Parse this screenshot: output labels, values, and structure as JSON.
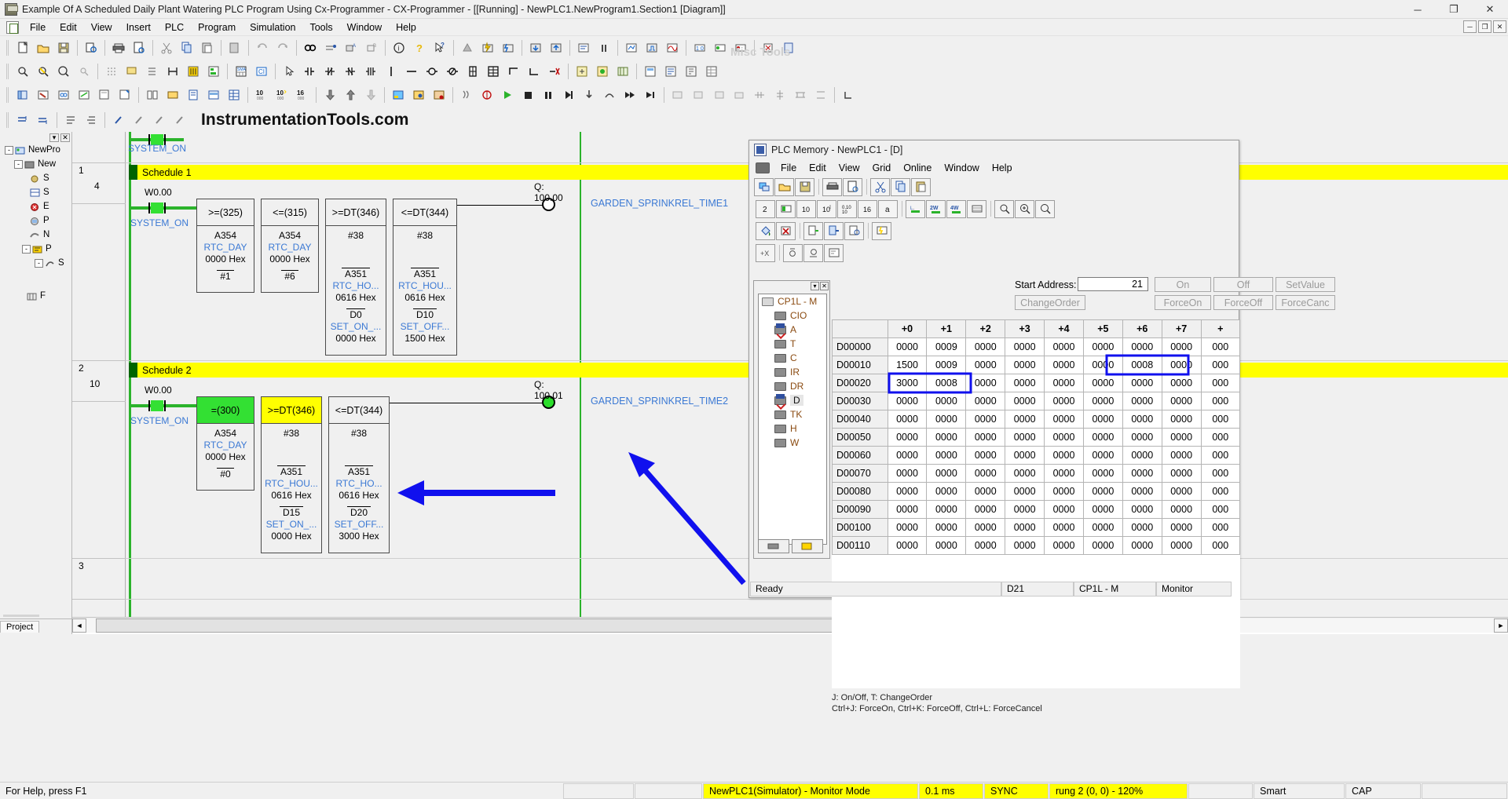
{
  "window": {
    "title": "Example Of A Scheduled Daily Plant Watering PLC Program Using Cx-Programmer - CX-Programmer - [[Running] - NewPLC1.NewProgram1.Section1 [Diagram]]",
    "minimize": "─",
    "maximize": "❐",
    "close": "✕",
    "mdi": [
      "─",
      "❐",
      "✕"
    ]
  },
  "menu": [
    "File",
    "Edit",
    "View",
    "Insert",
    "PLC",
    "Program",
    "Simulation",
    "Tools",
    "Window",
    "Help"
  ],
  "watermark": "InstrumentationTools.com",
  "ghost_label": "Misc Tools",
  "tree": {
    "close_btns": [
      "▾",
      "✕"
    ],
    "items": [
      {
        "label": "NewPro",
        "toggle": "-",
        "depth": 0,
        "icon": "project-icon"
      },
      {
        "label": "New",
        "toggle": "-",
        "depth": 1,
        "icon": "plc-icon"
      },
      {
        "label": "S",
        "toggle": "",
        "depth": 2,
        "icon": "symbol-icon"
      },
      {
        "label": "S",
        "toggle": "",
        "depth": 2,
        "icon": "iotable-icon"
      },
      {
        "label": "E",
        "toggle": "",
        "depth": 2,
        "icon": "error-icon"
      },
      {
        "label": "P",
        "toggle": "",
        "depth": 2,
        "icon": "memory-icon"
      },
      {
        "label": "N",
        "toggle": "",
        "depth": 2,
        "icon": "program-icon"
      },
      {
        "label": "P",
        "toggle": "-",
        "depth": 2,
        "icon": "section-icon"
      },
      {
        "label": "S",
        "toggle": "-",
        "depth": 3,
        "icon": "function-icon"
      },
      {
        "label": "F",
        "toggle": "",
        "depth": 2,
        "icon": "rack-icon"
      }
    ],
    "tab": "Project"
  },
  "ladder": {
    "rungs": [
      {
        "number": "",
        "step": "",
        "comment": ""
      },
      {
        "number": "1",
        "step": "4",
        "comment": "Schedule 1"
      },
      {
        "number": "2",
        "step": "10",
        "comment": "Schedule 2"
      },
      {
        "number": "3",
        "step": "",
        "comment": ""
      }
    ],
    "rung0": {
      "contact_label_bottom": "SYSTEM_ON"
    },
    "rung1": {
      "contact_top": "W0.00",
      "contact_bottom": "SYSTEM_ON",
      "coil_label": "Q: 100.00",
      "output_symbol": "GARDEN_SPRINKREL_TIME1",
      "blocks": [
        {
          "header": ">=(325)",
          "op1": "A354",
          "sym1": "RTC_DAY",
          "hex1": "0000 Hex",
          "op2": "#1",
          "sym2": "",
          "hex2": "",
          "op3": "",
          "sym3": "",
          "hex3": "",
          "fill": "plain"
        },
        {
          "header": "<=(315)",
          "op1": "A354",
          "sym1": "RTC_DAY",
          "hex1": "0000 Hex",
          "op2": "#6",
          "sym2": "",
          "hex2": "",
          "op3": "",
          "sym3": "",
          "hex3": "",
          "fill": "plain"
        },
        {
          "header": ">=DT(346)",
          "op1": "#38",
          "sym1": "",
          "hex1": "",
          "op2": "A351",
          "sym2": "RTC_HO...",
          "hex2": "0616 Hex",
          "op3": "D0",
          "sym3": "SET_ON_...",
          "hex3": "0000 Hex",
          "fill": "plain"
        },
        {
          "header": "<=DT(344)",
          "op1": "#38",
          "sym1": "",
          "hex1": "",
          "op2": "A351",
          "sym2": "RTC_HOU...",
          "hex2": "0616 Hex",
          "op3": "D10",
          "sym3": "SET_OFF...",
          "hex3": "1500 Hex",
          "fill": "plain"
        }
      ]
    },
    "rung2": {
      "contact_top": "W0.00",
      "contact_bottom": "SYSTEM_ON",
      "coil_label": "Q: 100.01",
      "output_symbol": "GARDEN_SPRINKREL_TIME2",
      "blocks": [
        {
          "header": "=(300)",
          "op1": "A354",
          "sym1": "RTC_DAY",
          "hex1": "0000 Hex",
          "op2": "#0",
          "sym2": "",
          "hex2": "",
          "op3": "",
          "sym3": "",
          "hex3": "",
          "fill": "green"
        },
        {
          "header": ">=DT(346)",
          "op1": "#38",
          "sym1": "",
          "hex1": "",
          "op2": "A351",
          "sym2": "RTC_HOU...",
          "hex2": "0616 Hex",
          "op3": "D15",
          "sym3": "SET_ON_...",
          "hex3": "0000 Hex",
          "fill": "yellow"
        },
        {
          "header": "<=DT(344)",
          "op1": "#38",
          "sym1": "",
          "hex1": "",
          "op2": "A351",
          "sym2": "RTC_HO...",
          "hex2": "0616 Hex",
          "op3": "D20",
          "sym3": "SET_OFF...",
          "hex3": "3000 Hex",
          "fill": "plain"
        }
      ]
    }
  },
  "memory": {
    "title": "PLC Memory - NewPLC1 - [D]",
    "menu": [
      "File",
      "Edit",
      "View",
      "Grid",
      "Online",
      "Window",
      "Help"
    ],
    "start_address_label": "Start Address:",
    "start_address_value": "21",
    "buttons": {
      "on": "On",
      "off": "Off",
      "set_value": "SetValue",
      "change_order": "ChangeOrder",
      "force_on": "ForceOn",
      "force_off": "ForceOff",
      "force_cancel": "ForceCanc"
    },
    "tree": {
      "root": "CP1L - M",
      "items": [
        "CIO",
        "A",
        "T",
        "C",
        "IR",
        "DR",
        "D",
        "TK",
        "H",
        "W"
      ],
      "selected": "D",
      "close_btns": [
        "▾",
        "✕"
      ]
    },
    "grid": {
      "columns": [
        "",
        "+0",
        "+1",
        "+2",
        "+3",
        "+4",
        "+5",
        "+6",
        "+7",
        "+"
      ],
      "rows": [
        {
          "addr": "D00000",
          "values": [
            "0000",
            "0009",
            "0000",
            "0000",
            "0000",
            "0000",
            "0000",
            "0000",
            "000"
          ]
        },
        {
          "addr": "D00010",
          "values": [
            "1500",
            "0009",
            "0000",
            "0000",
            "0000",
            "0000",
            "0008",
            "0000",
            "000"
          ]
        },
        {
          "addr": "D00020",
          "values": [
            "3000",
            "0008",
            "0000",
            "0000",
            "0000",
            "0000",
            "0000",
            "0000",
            "000"
          ]
        },
        {
          "addr": "D00030",
          "values": [
            "0000",
            "0000",
            "0000",
            "0000",
            "0000",
            "0000",
            "0000",
            "0000",
            "000"
          ]
        },
        {
          "addr": "D00040",
          "values": [
            "0000",
            "0000",
            "0000",
            "0000",
            "0000",
            "0000",
            "0000",
            "0000",
            "000"
          ]
        },
        {
          "addr": "D00050",
          "values": [
            "0000",
            "0000",
            "0000",
            "0000",
            "0000",
            "0000",
            "0000",
            "0000",
            "000"
          ]
        },
        {
          "addr": "D00060",
          "values": [
            "0000",
            "0000",
            "0000",
            "0000",
            "0000",
            "0000",
            "0000",
            "0000",
            "000"
          ]
        },
        {
          "addr": "D00070",
          "values": [
            "0000",
            "0000",
            "0000",
            "0000",
            "0000",
            "0000",
            "0000",
            "0000",
            "000"
          ]
        },
        {
          "addr": "D00080",
          "values": [
            "0000",
            "0000",
            "0000",
            "0000",
            "0000",
            "0000",
            "0000",
            "0000",
            "000"
          ]
        },
        {
          "addr": "D00090",
          "values": [
            "0000",
            "0000",
            "0000",
            "0000",
            "0000",
            "0000",
            "0000",
            "0000",
            "000"
          ]
        },
        {
          "addr": "D00100",
          "values": [
            "0000",
            "0000",
            "0000",
            "0000",
            "0000",
            "0000",
            "0000",
            "0000",
            "000"
          ]
        },
        {
          "addr": "D00110",
          "values": [
            "0000",
            "0000",
            "0000",
            "0000",
            "0000",
            "0000",
            "0000",
            "0000",
            "000"
          ]
        }
      ]
    },
    "hint_line1": "J:  On/Off,   T:  ChangeOrder",
    "hint_line2": "Ctrl+J:  ForceOn,   Ctrl+K:  ForceOff,   Ctrl+L:  ForceCancel",
    "status": {
      "ready": "Ready",
      "cell": "D21",
      "cpu": "CP1L - M",
      "mode": "Monitor"
    }
  },
  "statusbar": {
    "help": "For Help, press F1",
    "plc": "NewPLC1(Simulator) - Monitor Mode",
    "cycle": "0.1 ms",
    "sync": "SYNC",
    "rung": "rung 2 (0, 0) - 120%",
    "smart": "Smart",
    "cap": "CAP"
  }
}
